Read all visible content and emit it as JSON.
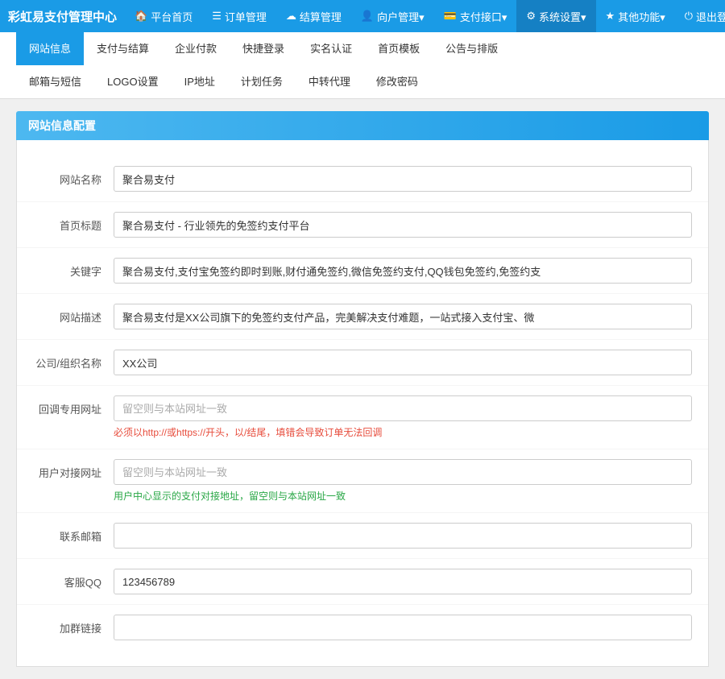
{
  "app": {
    "title": "彩虹易支付管理中心"
  },
  "topNav": {
    "items": [
      {
        "id": "home",
        "icon": "🏠",
        "label": "平台首页"
      },
      {
        "id": "orders",
        "icon": "📋",
        "label": "订单管理"
      },
      {
        "id": "settlement",
        "icon": "☁",
        "label": "结算管理"
      },
      {
        "id": "users",
        "icon": "👤",
        "label": "向户管理▾"
      },
      {
        "id": "payment",
        "icon": "💳",
        "label": "支付接口▾"
      },
      {
        "id": "settings",
        "icon": "⚙",
        "label": "系统设置▾"
      },
      {
        "id": "more",
        "icon": "★",
        "label": "其他功能▾"
      },
      {
        "id": "logout",
        "icon": "⏻",
        "label": "退出登"
      }
    ]
  },
  "subNav": {
    "row1": [
      {
        "id": "site-info",
        "label": "网站信息",
        "active": true
      },
      {
        "id": "payment-settle",
        "label": "支付与结算"
      },
      {
        "id": "company-pay",
        "label": "企业付款"
      },
      {
        "id": "quick-login",
        "label": "快捷登录"
      },
      {
        "id": "real-name",
        "label": "实名认证"
      },
      {
        "id": "home-template",
        "label": "首页模板"
      },
      {
        "id": "notice-sort",
        "label": "公告与排版"
      }
    ],
    "row2": [
      {
        "id": "email-sms",
        "label": "邮箱与短信"
      },
      {
        "id": "logo-settings",
        "label": "LOGO设置"
      },
      {
        "id": "ip-addr",
        "label": "IP地址"
      },
      {
        "id": "plan-task",
        "label": "计划任务"
      },
      {
        "id": "transfer-agent",
        "label": "中转代理"
      },
      {
        "id": "change-pwd",
        "label": "修改密码"
      }
    ]
  },
  "sectionTitle": "网站信息配置",
  "form": {
    "fields": [
      {
        "id": "site-name",
        "label": "网站名称",
        "type": "input",
        "value": "聚合易支付",
        "placeholder": ""
      },
      {
        "id": "home-title",
        "label": "首页标题",
        "type": "input",
        "value": "聚合易支付 - 行业领先的免签约支付平台",
        "placeholder": ""
      },
      {
        "id": "keywords",
        "label": "关键字",
        "type": "input",
        "value": "聚合易支付,支付宝免签约即时到账,财付通免签约,微信免签约支付,QQ钱包免签约,免签约支",
        "placeholder": ""
      },
      {
        "id": "site-desc",
        "label": "网站描述",
        "type": "input",
        "value": "聚合易支付是XX公司旗下的免签约支付产品，完美解决支付难题，一站式接入支付宝、微",
        "placeholder": ""
      },
      {
        "id": "company-name",
        "label": "公司/组织名称",
        "type": "input",
        "value": "XX公司",
        "placeholder": ""
      },
      {
        "id": "callback-url",
        "label": "回调专用网址",
        "type": "input",
        "value": "",
        "placeholder": "留空则与本站网址一致",
        "hint": "必须以http://或https://开头，以/结尾，填错会导致订单无法回调",
        "hintType": "warning"
      },
      {
        "id": "user-connect-url",
        "label": "用户对接网址",
        "type": "input",
        "value": "",
        "placeholder": "留空则与本站网址一致",
        "hint": "用户中心显示的支付对接地址，留空则与本站网址一致",
        "hintType": "normal"
      },
      {
        "id": "email",
        "label": "联系邮箱",
        "type": "input",
        "value": "",
        "placeholder": ""
      },
      {
        "id": "qq",
        "label": "客服QQ",
        "type": "input",
        "value": "123456789",
        "placeholder": ""
      },
      {
        "id": "group-link",
        "label": "加群链接",
        "type": "input",
        "value": "",
        "placeholder": ""
      }
    ]
  }
}
